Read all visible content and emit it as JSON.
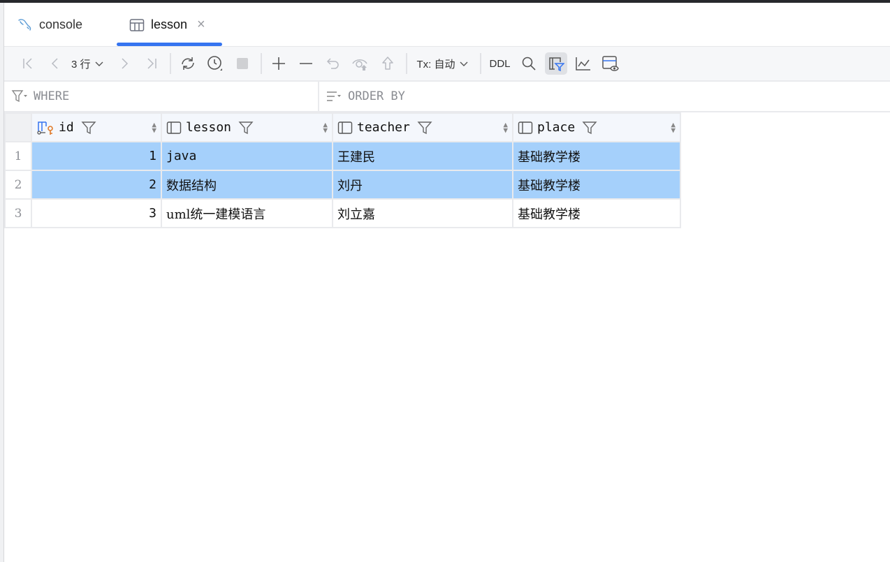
{
  "tabs": [
    {
      "label": "console",
      "icon": "mysql-dolphin-icon",
      "active": false
    },
    {
      "label": "lesson",
      "icon": "table-icon",
      "active": true,
      "closable": true
    }
  ],
  "toolbar": {
    "row_count": "3 行",
    "tx_label": "Tx: 自动",
    "ddl_label": "DDL"
  },
  "filters": {
    "where_placeholder": "WHERE",
    "order_placeholder": "ORDER BY"
  },
  "table": {
    "columns": [
      {
        "name": "id",
        "icon": "primary-key-icon"
      },
      {
        "name": "lesson",
        "icon": "column-icon"
      },
      {
        "name": "teacher",
        "icon": "column-icon"
      },
      {
        "name": "place",
        "icon": "column-icon"
      }
    ],
    "rows": [
      {
        "num": "1",
        "id": "1",
        "lesson": "java",
        "teacher": "王建民",
        "place": "基础教学楼",
        "selected": true
      },
      {
        "num": "2",
        "id": "2",
        "lesson": "数据结构",
        "teacher": "刘丹",
        "place": "基础教学楼",
        "selected": true
      },
      {
        "num": "3",
        "id": "3",
        "lesson": "uml统一建模语言",
        "teacher": "刘立嘉",
        "place": "基础教学楼",
        "selected": false
      }
    ]
  },
  "colors": {
    "accent": "#3574f0",
    "selection": "#a5d0fb",
    "key_icon": "#e07a2a"
  }
}
